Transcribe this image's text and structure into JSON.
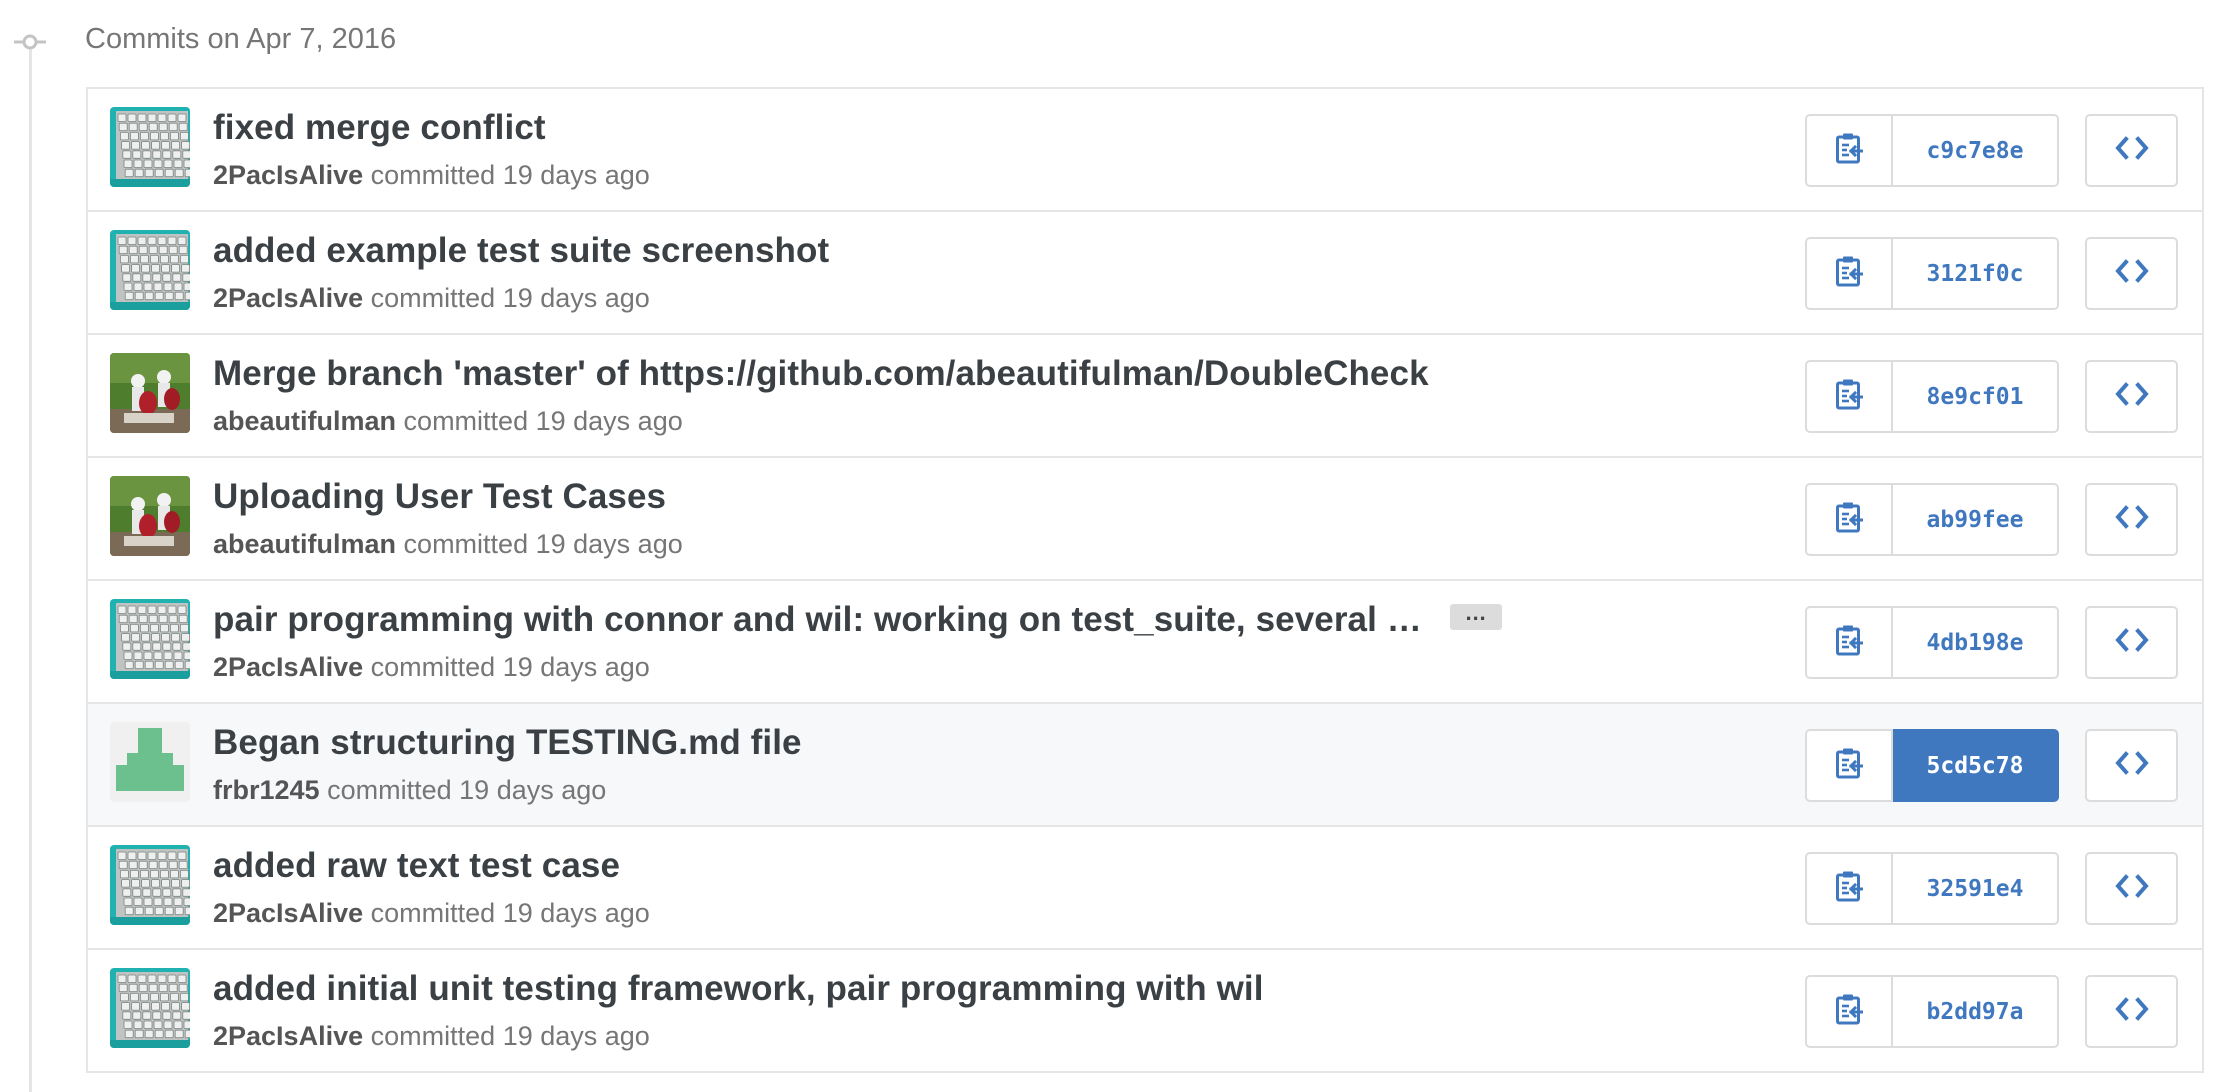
{
  "group": {
    "title": "Commits on Apr 7, 2016"
  },
  "commits": [
    {
      "title": "fixed merge conflict",
      "author": "2PacIsAlive",
      "committed_text": "committed",
      "time": "19 days ago",
      "sha": "c9c7e8e",
      "avatar": "keyboard-avatar"
    },
    {
      "title": "added example test suite screenshot",
      "author": "2PacIsAlive",
      "committed_text": "committed",
      "time": "19 days ago",
      "sha": "3121f0c",
      "avatar": "keyboard-avatar"
    },
    {
      "title": "Merge branch 'master' of https://github.com/abeautifulman/DoubleCheck",
      "author": "abeautifulman",
      "committed_text": "committed",
      "time": "19 days ago",
      "sha": "8e9cf01",
      "avatar": "stormtrooper-avatar"
    },
    {
      "title": "Uploading User Test Cases",
      "author": "abeautifulman",
      "committed_text": "committed",
      "time": "19 days ago",
      "sha": "ab99fee",
      "avatar": "stormtrooper-avatar"
    },
    {
      "title": "pair programming with connor and wil: working on test_suite, several …",
      "author": "2PacIsAlive",
      "committed_text": "committed",
      "time": "19 days ago",
      "sha": "4db198e",
      "avatar": "keyboard-avatar",
      "ellipsis": "…"
    },
    {
      "title": "Began structuring TESTING.md file",
      "author": "frbr1245",
      "committed_text": "committed",
      "time": "19 days ago",
      "sha": "5cd5c78",
      "avatar": "identicon-avatar",
      "selected": true
    },
    {
      "title": "added raw text test case",
      "author": "2PacIsAlive",
      "committed_text": "committed",
      "time": "19 days ago",
      "sha": "32591e4",
      "avatar": "keyboard-avatar"
    },
    {
      "title": "added initial unit testing framework, pair programming with wil",
      "author": "2PacIsAlive",
      "committed_text": "committed",
      "time": "19 days ago",
      "sha": "b2dd97a",
      "avatar": "keyboard-avatar"
    }
  ],
  "icons": {
    "copy": "clipboard-copy-icon",
    "browse": "code-brackets-icon",
    "timeline": "git-commit-icon"
  },
  "colors": {
    "link_blue": "#4078c0",
    "identicon_green": "#6cc08d",
    "keyboard_teal": "#20b1b1"
  }
}
